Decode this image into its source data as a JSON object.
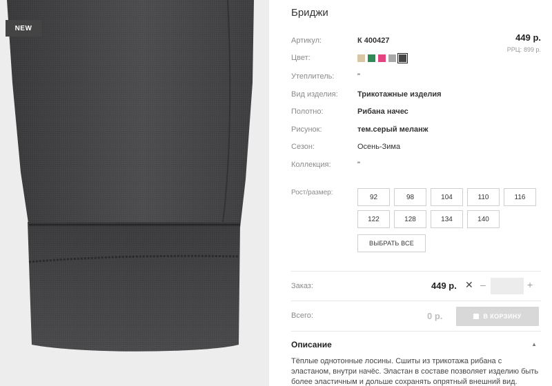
{
  "badge": "NEW",
  "product": {
    "title": "Бриджи",
    "price": "449 р.",
    "rrp_label": "РРЦ:",
    "rrp_value": "899 р."
  },
  "attributes": [
    {
      "label": "Артикул:",
      "value": "К 400427",
      "bold": true
    },
    {
      "label": "Цвет:",
      "value": "",
      "bold": false
    },
    {
      "label": "Утеплитель:",
      "value": "\"",
      "bold": false
    },
    {
      "label": "Вид изделия:",
      "value": "Трикотажные изделия",
      "bold": true
    },
    {
      "label": "Полотно:",
      "value": "Рибана начес",
      "bold": true
    },
    {
      "label": "Рисунок:",
      "value": "тем.серый меланж",
      "bold": true
    },
    {
      "label": "Сезон:",
      "value": "Осень-Зима",
      "bold": false
    },
    {
      "label": "Коллекция:",
      "value": "\"",
      "bold": false
    }
  ],
  "swatches": [
    {
      "color": "#d9c6a5",
      "selected": false
    },
    {
      "color": "#2f8a56",
      "selected": false
    },
    {
      "color": "#e3437f",
      "selected": false
    },
    {
      "color": "#a8a8a8",
      "selected": false
    },
    {
      "color": "#454545",
      "selected": true
    }
  ],
  "sizes_label": "Рост/размер:",
  "sizes": [
    "92",
    "98",
    "104",
    "110",
    "116",
    "122",
    "128",
    "134",
    "140"
  ],
  "select_all": "ВЫБРАТЬ ВСЕ",
  "order": {
    "label": "Заказ:",
    "price": "449 р.",
    "times": "✕",
    "minus": "–",
    "plus": "+",
    "quantity": ""
  },
  "total": {
    "label": "Всего:",
    "value": "0 р.",
    "cart_button": "В КОРЗИНУ"
  },
  "description": {
    "title": "Описание",
    "caret": "▲",
    "text": "Тёплые однотонные лосины. Сшиты из трикотажа рибана с эластаном, внутри начёс. Эластан в составе позволяет изделию быть более эластичным и дольше сохранять опрятный внешний вид."
  },
  "colors": {
    "fabric": "#4a4a4c",
    "background": "#ededed",
    "badge_bg": "#444444",
    "button_disabled": "#d8d8d8"
  }
}
